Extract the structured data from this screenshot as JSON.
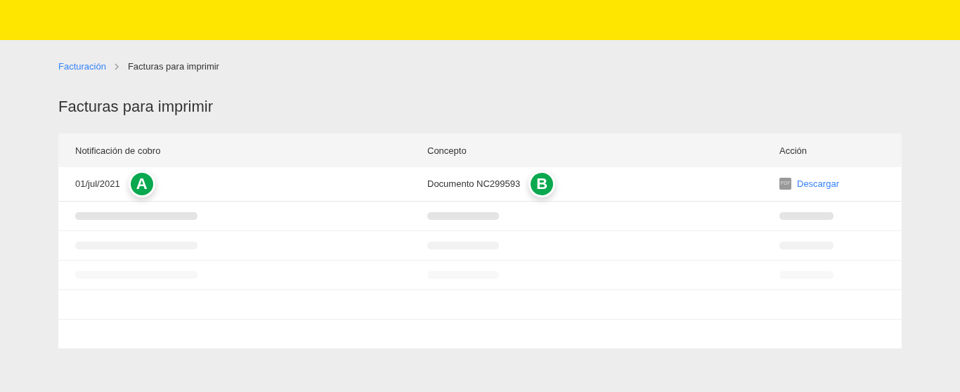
{
  "breadcrumb": {
    "items": [
      {
        "label": "Facturación",
        "kind": "link"
      },
      {
        "label": "Facturas para imprimir",
        "kind": "current"
      }
    ]
  },
  "title": "Facturas para imprimir",
  "table": {
    "columns": [
      "Notificación de cobro",
      "Concepto",
      "Acción"
    ],
    "rows": [
      {
        "date": "01/jul/2021",
        "date_marker": "A",
        "concept": "Documento NC299593",
        "concept_marker": "B",
        "file_icon": "PDF",
        "action": "Descargar"
      }
    ],
    "skeleton_rows": [
      {
        "color": "#e4e4e4"
      },
      {
        "color": "#f2f2f2"
      },
      {
        "color": "#f8f8f8"
      }
    ]
  }
}
